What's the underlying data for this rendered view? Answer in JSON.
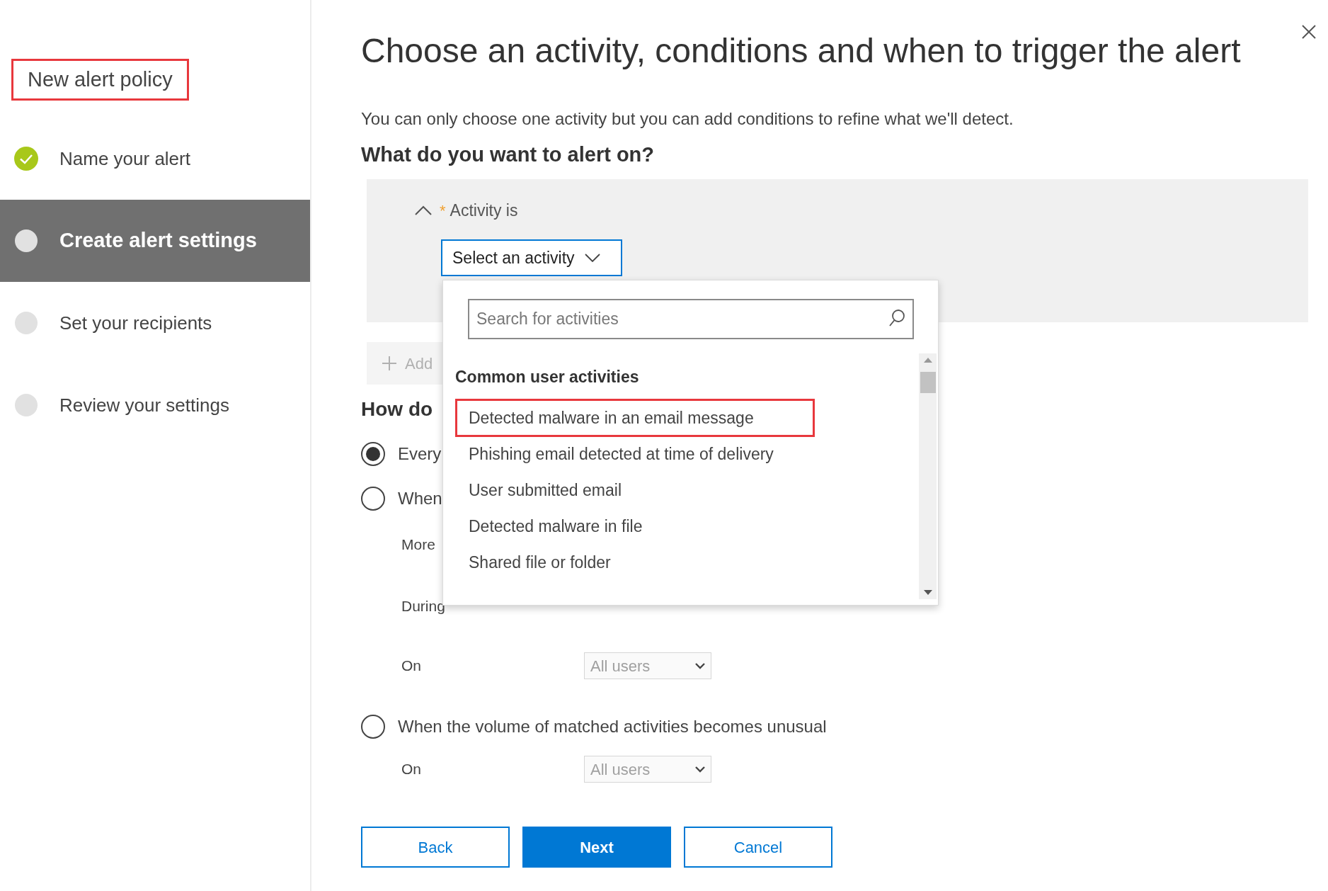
{
  "sidebar": {
    "title": {
      "text": "New alert policy",
      "highlighted": true
    },
    "steps": [
      {
        "label": "Name your alert",
        "done": true,
        "selected": false
      },
      {
        "label": "Create alert settings",
        "done": false,
        "selected": true
      },
      {
        "label": "Set your recipients",
        "done": false,
        "selected": false
      },
      {
        "label": "Review your settings",
        "done": false,
        "selected": false
      }
    ]
  },
  "heading": "Choose an activity, conditions and when to trigger the alert",
  "description": "You can only choose one activity but you can add conditions to refine what we'll detect.",
  "section_title": "What do you want to alert on?",
  "activity_panel": {
    "expanded": true,
    "required": true,
    "required_mark": "*",
    "label": "Activity is",
    "select": {
      "value": "Select an activity",
      "open": true
    }
  },
  "add_button": "Add",
  "dropdown": {
    "search": {
      "placeholder": "Search for activities"
    },
    "group_title": "Common user activities",
    "items": [
      {
        "label": "Detected malware in an email message",
        "highlighted": true
      },
      {
        "label": "Phishing email detected at time of delivery",
        "highlighted": false
      },
      {
        "label": "User submitted email",
        "highlighted": false
      },
      {
        "label": "Detected malware in file",
        "highlighted": false
      },
      {
        "label": "Shared file or folder",
        "highlighted": false
      }
    ]
  },
  "frequency": {
    "title": "How do",
    "options": [
      {
        "label": "Every",
        "selected": true
      },
      {
        "label": "When",
        "selected": false
      }
    ],
    "threshold": {
      "more_label": "More",
      "during_label": "During",
      "on_label": "On",
      "on_select": {
        "value": "All users",
        "disabled": true
      }
    },
    "unusual": {
      "label": "When the volume of matched activities becomes unusual",
      "selected": false,
      "on_label": "On",
      "on_select": {
        "value": "All users",
        "disabled": true
      }
    }
  },
  "buttons": [
    {
      "label": "Back",
      "kind": "secondary"
    },
    {
      "label": "Next",
      "kind": "primary"
    },
    {
      "label": "Cancel",
      "kind": "secondary"
    }
  ]
}
